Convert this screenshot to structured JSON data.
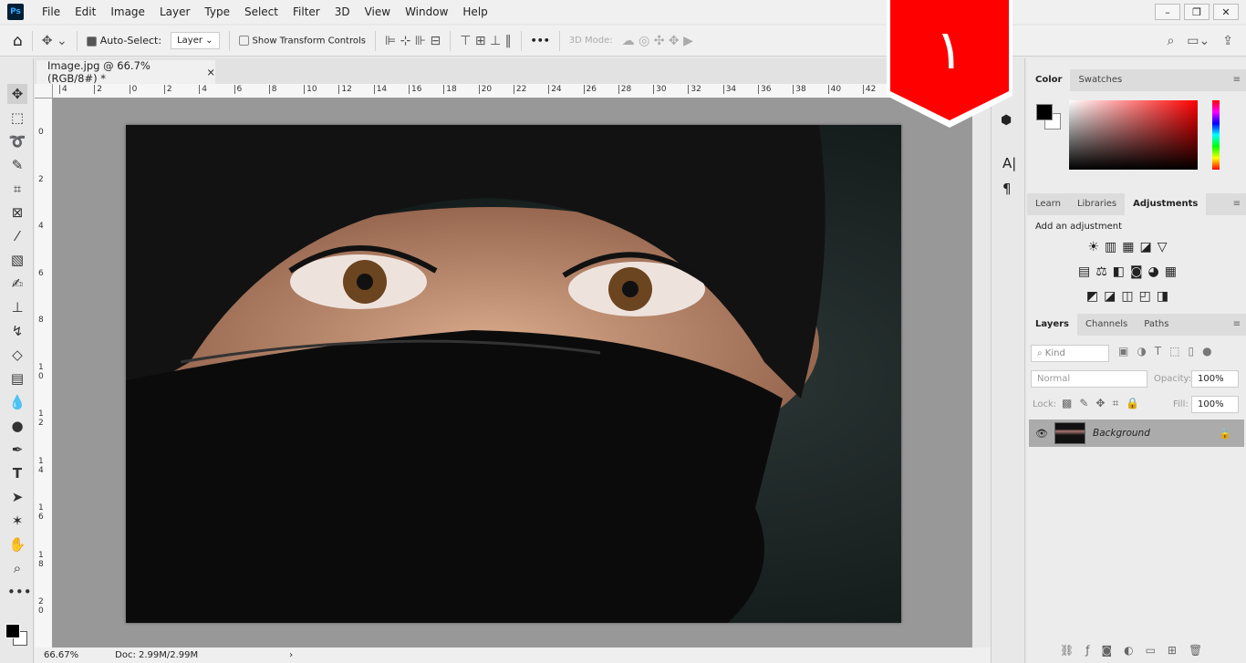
{
  "app": {
    "logo": "Ps"
  },
  "menu": [
    "File",
    "Edit",
    "Image",
    "Layer",
    "Type",
    "Select",
    "Filter",
    "3D",
    "View",
    "Window",
    "Help"
  ],
  "window_controls": [
    "minimize",
    "restore",
    "close"
  ],
  "options": {
    "auto_select_label": "Auto-Select:",
    "auto_select_checked": true,
    "layer_select": "Layer",
    "show_transform_label": "Show Transform Controls",
    "show_transform_checked": false,
    "more": "•••",
    "mode3d_label": "3D Mode:"
  },
  "document_tab": {
    "title": "Image.jpg @ 66.7% (RGB/8#) *",
    "close": "×"
  },
  "rulers": {
    "horizontal": [
      "4",
      "2",
      "0",
      "2",
      "4",
      "6",
      "8",
      "10",
      "12",
      "14",
      "16",
      "18",
      "20",
      "22",
      "24",
      "26",
      "28",
      "30",
      "32",
      "34",
      "36",
      "38",
      "40",
      "42"
    ],
    "vertical": [
      "0",
      "2",
      "4",
      "6",
      "8",
      "10",
      "12",
      "14",
      "16",
      "18",
      "20"
    ]
  },
  "status": {
    "zoom": "66.67%",
    "doc": "Doc: 2.99M/2.99M",
    "arrow": "›"
  },
  "badge": {
    "text": "١",
    "color": "#ff0000"
  },
  "color_panel": {
    "tabs": [
      "Color",
      "Swatches"
    ],
    "active": "Color",
    "foreground": "#000000",
    "background": "#ffffff",
    "hue": "#ff0000"
  },
  "adjust_panel": {
    "tabs": [
      "Learn",
      "Libraries",
      "Adjustments"
    ],
    "active": "Adjustments",
    "hint": "Add an adjustment"
  },
  "layers_panel": {
    "tabs": [
      "Layers",
      "Channels",
      "Paths"
    ],
    "active": "Layers",
    "filter": "Kind",
    "blend_mode": "Normal",
    "opacity_label": "Opacity:",
    "opacity": "100%",
    "lock_label": "Lock:",
    "fill_label": "Fill:",
    "fill": "100%",
    "layers": [
      {
        "name": "Background",
        "visible": true,
        "locked": true
      }
    ],
    "footer_icons": [
      "link",
      "fx",
      "mask",
      "adjustment",
      "group",
      "new-layer",
      "delete"
    ]
  }
}
